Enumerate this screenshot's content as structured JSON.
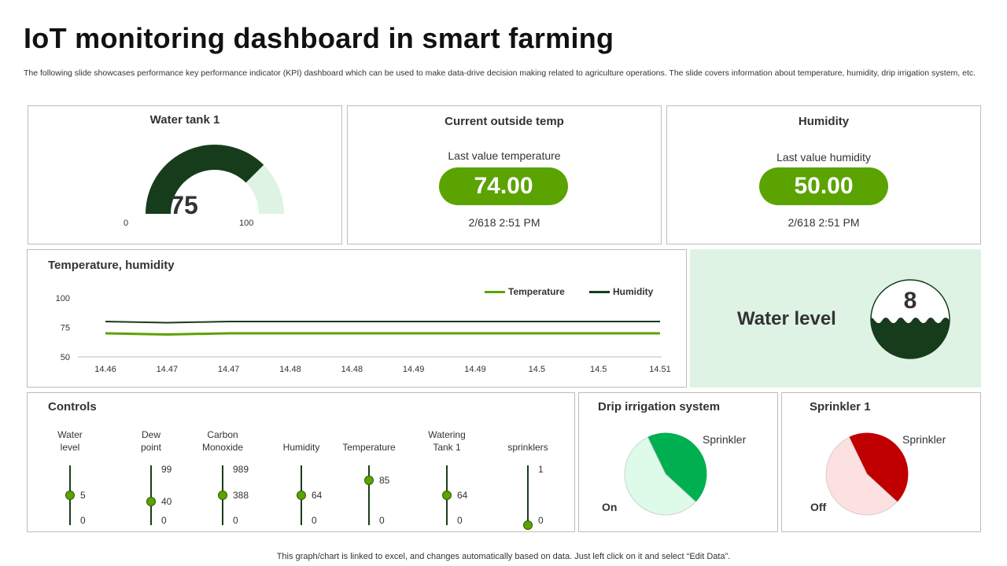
{
  "header": {
    "title": "IoT monitoring dashboard in smart farming",
    "subtitle": "The following slide showcases performance key performance indicator (KPI) dashboard which can be used to make data-drive decision making related to agriculture operations. The slide covers information about temperature, humidity, drip irrigation system, etc."
  },
  "water_tank": {
    "title": "Water tank 1",
    "value": "75",
    "min_label": "0",
    "max_label": "100",
    "fill_fraction": 0.75,
    "colors": {
      "fill": "#163c1c",
      "track": "#dff3e4"
    }
  },
  "outside_temp": {
    "title": "Current outside temp",
    "caption": "Last value temperature",
    "value": "74.00",
    "timestamp": "2/618 2:51 PM"
  },
  "humidity_card": {
    "title": "Humidity",
    "caption": "Last value humidity",
    "value": "50.00",
    "timestamp": "2/618 2:51 PM"
  },
  "trend": {
    "title": "Temperature, humidity"
  },
  "water_level": {
    "label": "Water level",
    "value": "8",
    "colors": {
      "panel_bg": "#dff3e4",
      "water": "#163c1c"
    }
  },
  "controls": {
    "title": "Controls",
    "items": [
      {
        "label_lines": [
          "Water",
          "level"
        ],
        "max": "",
        "value": "5",
        "min": "0",
        "fraction": 0.5
      },
      {
        "label_lines": [
          "Dew",
          "point"
        ],
        "max": "99",
        "value": "40",
        "min": "0",
        "fraction": 0.4
      },
      {
        "label_lines": [
          "Carbon",
          "Monoxide"
        ],
        "max": "989",
        "value": "388",
        "min": "0",
        "fraction": 0.5
      },
      {
        "label_lines": [
          "",
          "Humidity"
        ],
        "max": "",
        "value": "64",
        "min": "0",
        "fraction": 0.5
      },
      {
        "label_lines": [
          "",
          "Temperature"
        ],
        "max": "",
        "value": "85",
        "min": "0",
        "fraction": 0.75
      },
      {
        "label_lines": [
          "Watering",
          "Tank 1"
        ],
        "max": "",
        "value": "64",
        "min": "0",
        "fraction": 0.5
      },
      {
        "label_lines": [
          "",
          "sprinklers"
        ],
        "max": "1",
        "value": "",
        "min": "0",
        "fraction": 0.0
      }
    ]
  },
  "drip": {
    "title": "Drip irrigation system",
    "slice_label": "Sprinkler",
    "state_label": "On",
    "colors": {
      "main": "#00b050",
      "light": "#ddfbe8"
    }
  },
  "sprinkler": {
    "title": "Sprinkler 1",
    "slice_label": "Sprinkler",
    "state_label": "Off",
    "colors": {
      "main": "#c00000",
      "light": "#fde0e0"
    }
  },
  "footer": {
    "note": "This graph/chart is linked to excel,  and changes automatically based on data. Just left click on it and select “Edit Data”."
  },
  "chart_data": [
    {
      "type": "line",
      "title": "Temperature, humidity",
      "categories": [
        "14.46",
        "14.47",
        "14.47",
        "14.48",
        "14.48",
        "14.49",
        "14.49",
        "14.5",
        "14.5",
        "14.51"
      ],
      "series": [
        {
          "name": "Temperature",
          "color": "#5ba300",
          "values": [
            70,
            69,
            70,
            70,
            70,
            70,
            70,
            70,
            70,
            70
          ]
        },
        {
          "name": "Humidity",
          "color": "#163c1c",
          "values": [
            80,
            79,
            80,
            80,
            80,
            80,
            80,
            80,
            80,
            80
          ]
        }
      ],
      "yticks": [
        "50",
        "75",
        "100"
      ],
      "ylim": [
        50,
        100
      ],
      "grid": false,
      "legend": "top-right"
    },
    {
      "type": "pie",
      "title": "Drip irrigation system",
      "slices": [
        {
          "name": "On",
          "value": 44,
          "color": "#00b050"
        },
        {
          "name": "Sprinkler",
          "value": 56,
          "color": "#ddfbe8"
        }
      ]
    },
    {
      "type": "pie",
      "title": "Sprinkler 1",
      "slices": [
        {
          "name": "Off",
          "value": 44,
          "color": "#c00000"
        },
        {
          "name": "Sprinkler",
          "value": 56,
          "color": "#fde0e0"
        }
      ]
    }
  ]
}
